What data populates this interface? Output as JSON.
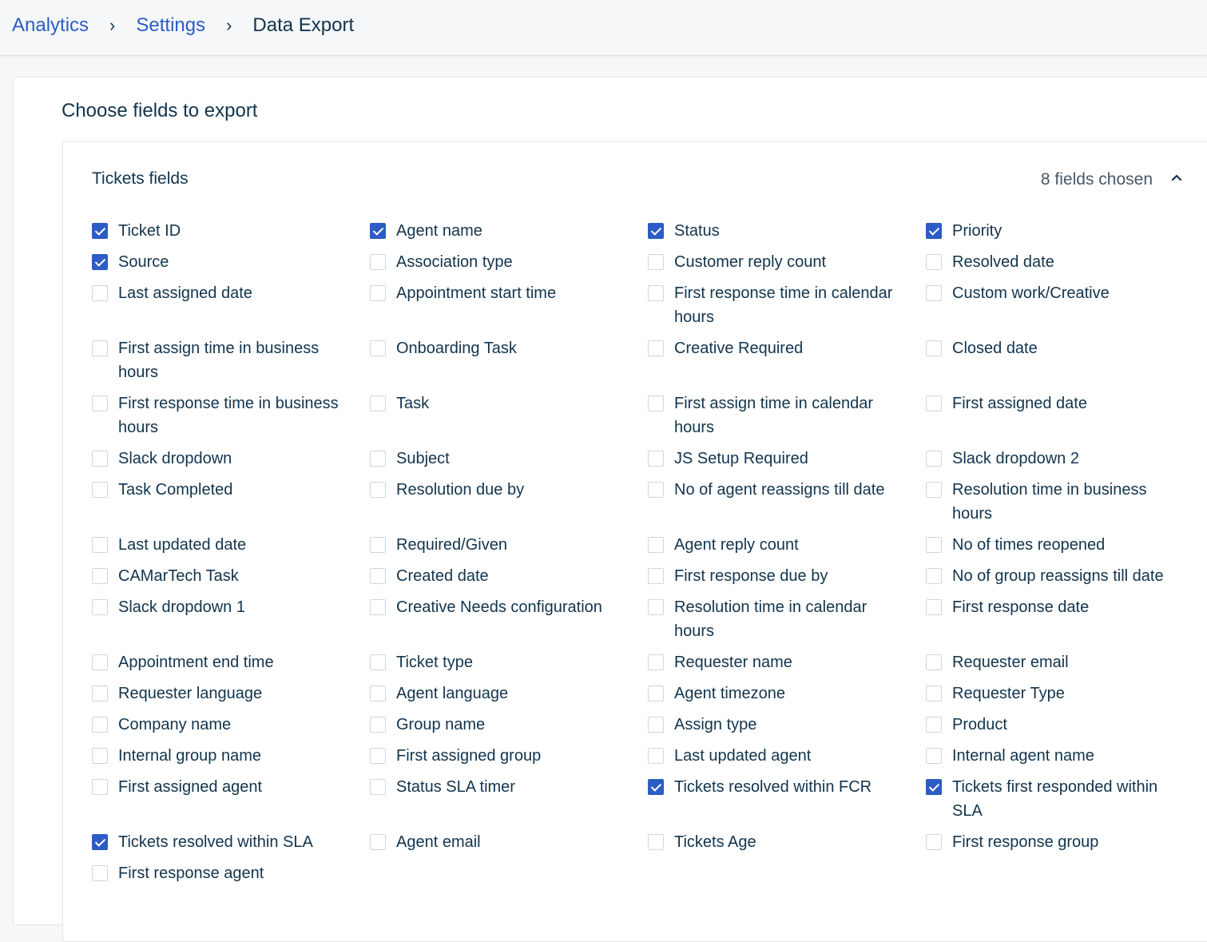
{
  "breadcrumb": {
    "items": [
      "Analytics",
      "Settings"
    ],
    "separator": "›",
    "current": "Data Export"
  },
  "export": {
    "title": "Choose fields to export",
    "section": {
      "title": "Tickets fields",
      "count_text": "8 fields chosen",
      "toggle_icon": "chevron-up-icon"
    }
  },
  "colors": {
    "accent": "#2c5cc5",
    "text": "#12344d",
    "border": "#cfd7df"
  },
  "fields": [
    {
      "label": "Ticket ID",
      "checked": true
    },
    {
      "label": "Agent name",
      "checked": true
    },
    {
      "label": "Status",
      "checked": true
    },
    {
      "label": "Priority",
      "checked": true
    },
    {
      "label": "Source",
      "checked": true
    },
    {
      "label": "Association type",
      "checked": false
    },
    {
      "label": "Customer reply count",
      "checked": false
    },
    {
      "label": "Resolved date",
      "checked": false
    },
    {
      "label": "Last assigned date",
      "checked": false
    },
    {
      "label": "Appointment start time",
      "checked": false
    },
    {
      "label": "First response time in calendar hours",
      "checked": false
    },
    {
      "label": "Custom work/Creative",
      "checked": false
    },
    {
      "label": "First assign time in business hours",
      "checked": false
    },
    {
      "label": "Onboarding Task",
      "checked": false
    },
    {
      "label": "Creative Required",
      "checked": false
    },
    {
      "label": "Closed date",
      "checked": false
    },
    {
      "label": "First response time in business hours",
      "checked": false
    },
    {
      "label": "Task",
      "checked": false
    },
    {
      "label": "First assign time in calendar hours",
      "checked": false
    },
    {
      "label": "First assigned date",
      "checked": false
    },
    {
      "label": "Slack dropdown",
      "checked": false
    },
    {
      "label": "Subject",
      "checked": false
    },
    {
      "label": "JS Setup Required",
      "checked": false
    },
    {
      "label": "Slack dropdown 2",
      "checked": false
    },
    {
      "label": "Task Completed",
      "checked": false
    },
    {
      "label": "Resolution due by",
      "checked": false
    },
    {
      "label": "No of agent reassigns till date",
      "checked": false
    },
    {
      "label": "Resolution time in business hours",
      "checked": false
    },
    {
      "label": "Last updated date",
      "checked": false
    },
    {
      "label": "Required/Given",
      "checked": false
    },
    {
      "label": "Agent reply count",
      "checked": false
    },
    {
      "label": "No of times reopened",
      "checked": false
    },
    {
      "label": "CAMarTech Task",
      "checked": false
    },
    {
      "label": "Created date",
      "checked": false
    },
    {
      "label": "First response due by",
      "checked": false
    },
    {
      "label": "No of group reassigns till date",
      "checked": false
    },
    {
      "label": "Slack dropdown 1",
      "checked": false
    },
    {
      "label": "Creative Needs configuration",
      "checked": false
    },
    {
      "label": "Resolution time in calendar hours",
      "checked": false
    },
    {
      "label": "First response date",
      "checked": false
    },
    {
      "label": "Appointment end time",
      "checked": false
    },
    {
      "label": "Ticket type",
      "checked": false
    },
    {
      "label": "Requester name",
      "checked": false
    },
    {
      "label": "Requester email",
      "checked": false
    },
    {
      "label": "Requester language",
      "checked": false
    },
    {
      "label": "Agent language",
      "checked": false
    },
    {
      "label": "Agent timezone",
      "checked": false
    },
    {
      "label": "Requester Type",
      "checked": false
    },
    {
      "label": "Company name",
      "checked": false
    },
    {
      "label": "Group name",
      "checked": false
    },
    {
      "label": "Assign type",
      "checked": false
    },
    {
      "label": "Product",
      "checked": false
    },
    {
      "label": "Internal group name",
      "checked": false
    },
    {
      "label": "First assigned group",
      "checked": false
    },
    {
      "label": "Last updated agent",
      "checked": false
    },
    {
      "label": "Internal agent name",
      "checked": false
    },
    {
      "label": "First assigned agent",
      "checked": false
    },
    {
      "label": "Status SLA timer",
      "checked": false
    },
    {
      "label": "Tickets resolved within FCR",
      "checked": true
    },
    {
      "label": "Tickets first responded within SLA",
      "checked": true
    },
    {
      "label": "Tickets resolved within SLA",
      "checked": true
    },
    {
      "label": "Agent email",
      "checked": false
    },
    {
      "label": "Tickets Age",
      "checked": false
    },
    {
      "label": "First response group",
      "checked": false
    },
    {
      "label": "First response agent",
      "checked": false
    }
  ]
}
